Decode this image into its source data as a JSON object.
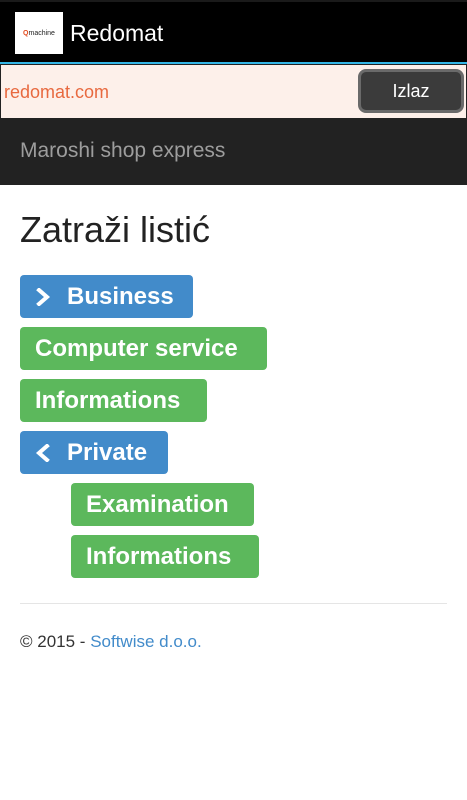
{
  "app": {
    "title": "Redomat",
    "logo_text_accent": "Q",
    "logo_text_rest": "machine"
  },
  "webbar": {
    "url": "redomat.com",
    "exit_label": "Izlaz"
  },
  "navbar": {
    "brand": "Maroshi shop express"
  },
  "page": {
    "title": "Zatraži listić"
  },
  "groups": [
    {
      "label": "Business",
      "icon": "chevron-right-icon",
      "color": "#428bca"
    },
    {
      "label": "Computer service",
      "color": "#5cb85c"
    },
    {
      "label": "Informations",
      "color": "#5cb85c"
    },
    {
      "label": "Private",
      "icon": "chevron-left-icon",
      "color": "#428bca"
    },
    {
      "label": "Examination",
      "color": "#5cb85c"
    },
    {
      "label": "Informations",
      "color": "#5cb85c"
    }
  ],
  "footer": {
    "prefix": "© 2015 - ",
    "link": "Softwise d.o.o."
  },
  "colors": {
    "primary": "#428bca",
    "success": "#5cb85c",
    "appbar_accent": "#33b5e5",
    "url_text": "#e8693f"
  }
}
